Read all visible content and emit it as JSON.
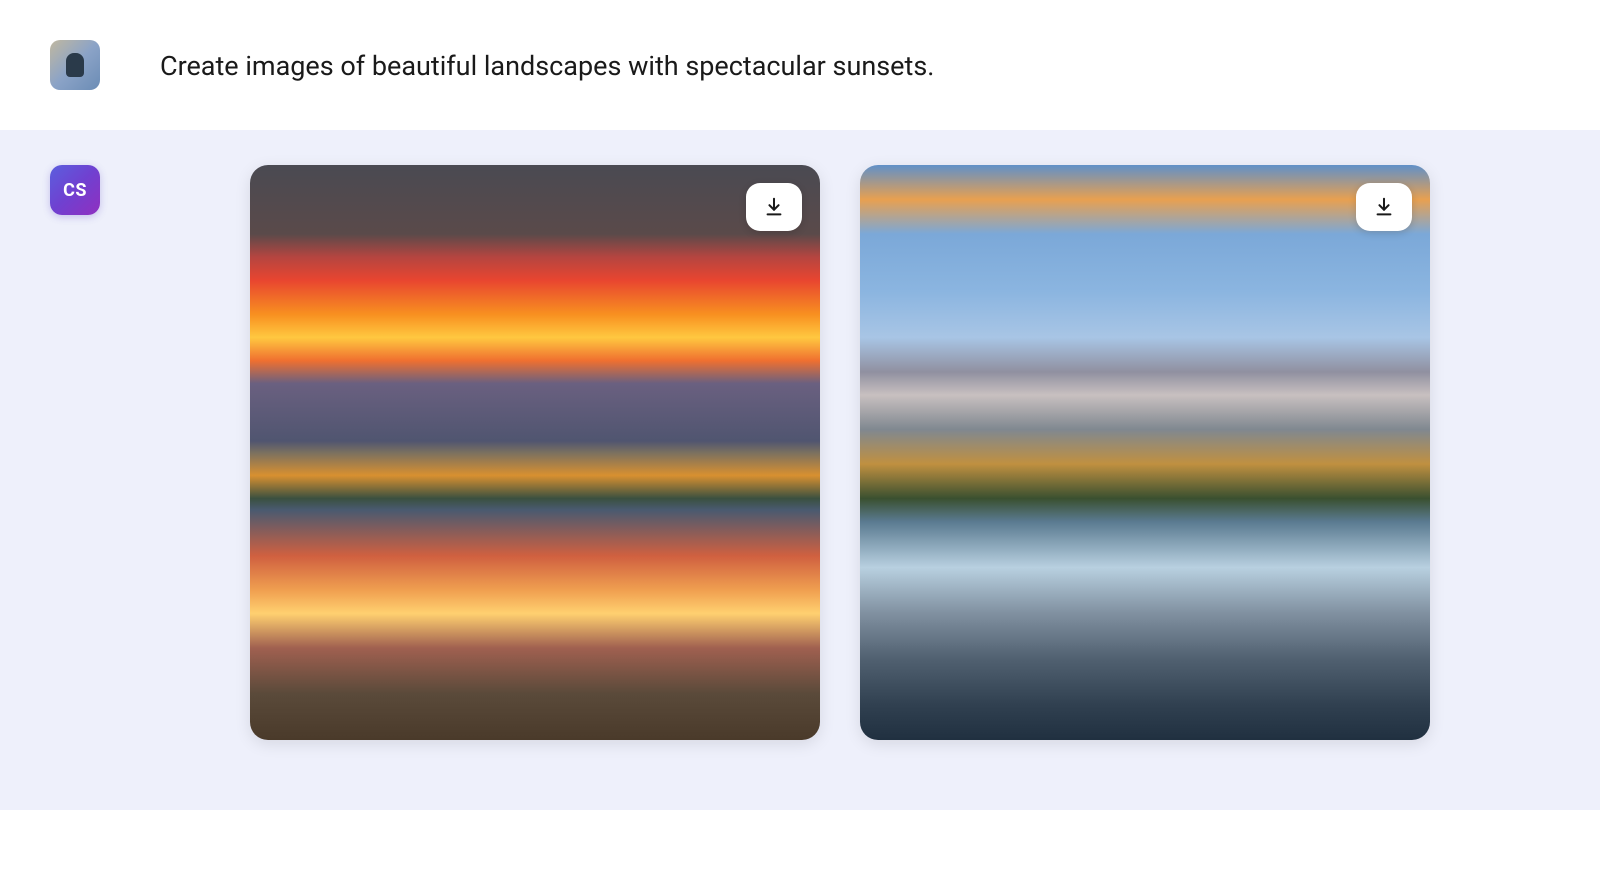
{
  "user": {
    "prompt": "Create images of beautiful landscapes with spectacular sunsets."
  },
  "ai": {
    "avatar_label": "CS"
  },
  "images": [
    {
      "alt": "Landscape with red sunset sky over mountains reflected in a lake",
      "download_label": "Download image 1"
    },
    {
      "alt": "Landscape with snow-capped mountains and pine trees reflected in a calm lake at sunset",
      "download_label": "Download image 2"
    }
  ],
  "colors": {
    "ai_response_bg": "#eef0fb",
    "ai_avatar_gradient_start": "#5b5fde",
    "ai_avatar_gradient_end": "#9030c0"
  }
}
